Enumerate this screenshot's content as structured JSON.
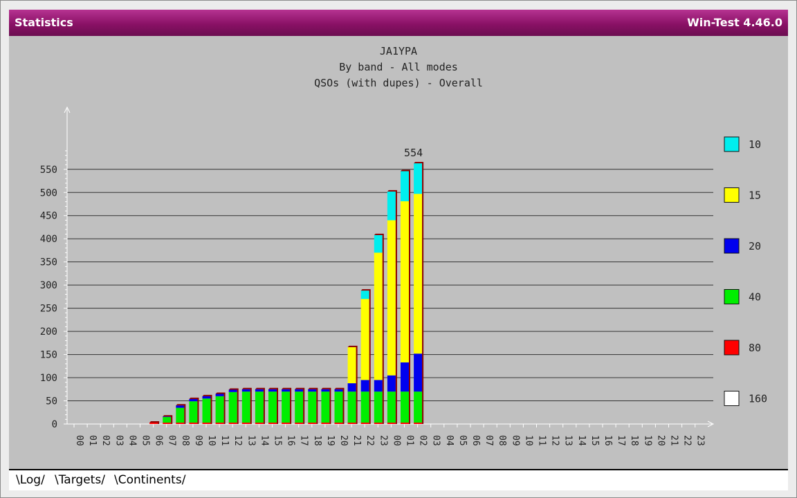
{
  "window": {
    "title": "Statistics",
    "app": "Win-Test 4.46.0"
  },
  "tabs": [
    {
      "label": "Log"
    },
    {
      "label": "Targets"
    },
    {
      "label": "Continents"
    }
  ],
  "chart_data": {
    "type": "bar",
    "stacked": true,
    "title_lines": [
      "JA1YPA",
      "By band - All modes",
      "QSOs (with dupes) - Overall"
    ],
    "xlabel": "",
    "ylabel": "",
    "ylim": [
      0,
      600
    ],
    "yticks": [
      0,
      50,
      100,
      150,
      200,
      250,
      300,
      350,
      400,
      450,
      500,
      550
    ],
    "grid": true,
    "legend_position": "right",
    "peak_label": "554",
    "categories": [
      "00",
      "01",
      "02",
      "03",
      "04",
      "05",
      "06",
      "07",
      "08",
      "09",
      "10",
      "11",
      "12",
      "13",
      "14",
      "15",
      "16",
      "17",
      "18",
      "19",
      "20",
      "21",
      "22",
      "23",
      "00",
      "01",
      "02",
      "03",
      "04",
      "05",
      "06",
      "07",
      "08",
      "09",
      "10",
      "11",
      "12",
      "13",
      "14",
      "15",
      "16",
      "17",
      "18",
      "19",
      "20",
      "21",
      "22",
      "23"
    ],
    "series": [
      {
        "name": "160",
        "color": "#ffffff",
        "values": [
          0,
          0,
          0,
          0,
          0,
          0,
          0,
          0,
          0,
          0,
          0,
          0,
          0,
          0,
          0,
          0,
          0,
          0,
          0,
          0,
          0,
          0,
          0,
          0,
          0,
          0,
          0,
          0,
          0,
          0,
          0,
          0,
          0,
          0,
          0,
          0,
          0,
          0,
          0,
          0,
          0,
          0,
          0,
          0,
          0,
          0,
          0,
          0
        ]
      },
      {
        "name": "80",
        "color": "#ff0000",
        "values": [
          0,
          0,
          0,
          0,
          0,
          0,
          3,
          3,
          3,
          3,
          3,
          3,
          3,
          3,
          3,
          3,
          3,
          3,
          3,
          3,
          3,
          3,
          3,
          3,
          3,
          3,
          3,
          0,
          0,
          0,
          0,
          0,
          0,
          0,
          0,
          0,
          0,
          0,
          0,
          0,
          0,
          0,
          0,
          0,
          0,
          0,
          0,
          0
        ]
      },
      {
        "name": "40",
        "color": "#00ee00",
        "values": [
          0,
          0,
          0,
          0,
          0,
          0,
          0,
          12,
          32,
          46,
          52,
          57,
          66,
          67,
          67,
          67,
          67,
          67,
          67,
          67,
          67,
          67,
          67,
          67,
          67,
          67,
          67,
          0,
          0,
          0,
          0,
          0,
          0,
          0,
          0,
          0,
          0,
          0,
          0,
          0,
          0,
          0,
          0,
          0,
          0,
          0,
          0,
          0
        ]
      },
      {
        "name": "20",
        "color": "#0000ee",
        "values": [
          0,
          0,
          0,
          0,
          0,
          0,
          0,
          1,
          5,
          5,
          5,
          5,
          5,
          5,
          5,
          5,
          5,
          5,
          5,
          5,
          5,
          18,
          25,
          25,
          35,
          63,
          82,
          0,
          0,
          0,
          0,
          0,
          0,
          0,
          0,
          0,
          0,
          0,
          0,
          0,
          0,
          0,
          0,
          0,
          0,
          0,
          0,
          0
        ]
      },
      {
        "name": "15",
        "color": "#ffff00",
        "values": [
          0,
          0,
          0,
          0,
          0,
          0,
          0,
          0,
          0,
          0,
          0,
          0,
          0,
          0,
          0,
          0,
          0,
          0,
          0,
          0,
          0,
          78,
          175,
          275,
          335,
          348,
          345,
          0,
          0,
          0,
          0,
          0,
          0,
          0,
          0,
          0,
          0,
          0,
          0,
          0,
          0,
          0,
          0,
          0,
          0,
          0,
          0,
          0
        ]
      },
      {
        "name": "10",
        "color": "#00eeee",
        "values": [
          0,
          0,
          0,
          0,
          0,
          0,
          0,
          0,
          0,
          0,
          0,
          0,
          0,
          0,
          0,
          0,
          0,
          0,
          0,
          0,
          0,
          0,
          18,
          38,
          62,
          65,
          66,
          0,
          0,
          0,
          0,
          0,
          0,
          0,
          0,
          0,
          0,
          0,
          0,
          0,
          0,
          0,
          0,
          0,
          0,
          0,
          0,
          0
        ]
      }
    ]
  }
}
